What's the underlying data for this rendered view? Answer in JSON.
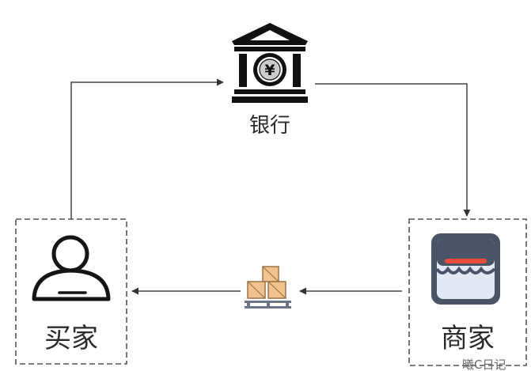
{
  "nodes": {
    "bank": {
      "label": "银行"
    },
    "buyer": {
      "label": "买家"
    },
    "seller": {
      "label": "商家"
    }
  },
  "bank_icon": {
    "symbol": "¥"
  },
  "colors": {
    "line": "#444444",
    "box_border": "#555555",
    "icon_dark": "#111111",
    "shop_frame": "#4b5467",
    "shop_fill": "#e3e8f4",
    "shop_stripe": "#e74c3c",
    "crate_fill": "#f1c28c",
    "crate_stroke": "#9b7448",
    "pallet": "#6b7388"
  },
  "watermark": "曦C日记"
}
